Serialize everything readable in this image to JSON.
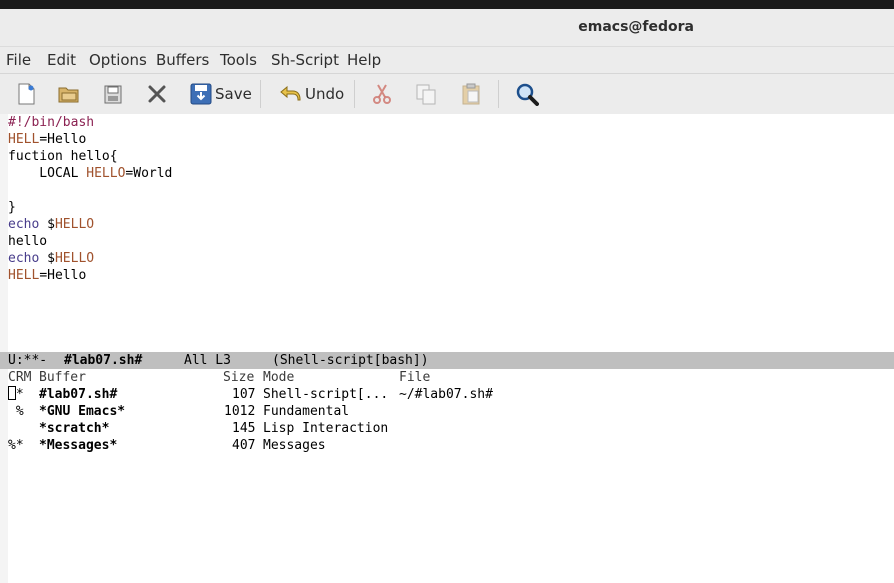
{
  "window": {
    "title": "emacs@fedora"
  },
  "menu": [
    "File",
    "Edit",
    "Options",
    "Buffers",
    "Tools",
    "Sh-Script",
    "Help"
  ],
  "toolbar": {
    "save_label": "Save",
    "undo_label": "Undo",
    "icons": [
      "new-file-icon",
      "open-folder-icon",
      "save-disk-icon",
      "close-icon",
      "save-icon",
      "undo-icon",
      "cut-icon",
      "copy-icon",
      "paste-icon",
      "search-icon"
    ]
  },
  "editor": {
    "lines": [
      {
        "parts": [
          {
            "t": "#!/bin/",
            "c": "pp"
          },
          {
            "t": "bash",
            "c": "pp"
          }
        ]
      },
      {
        "parts": [
          {
            "t": "HELL",
            "c": "var"
          },
          {
            "t": "=Hello",
            "c": ""
          }
        ]
      },
      {
        "parts": [
          {
            "t": "fuction hello{",
            "c": ""
          }
        ]
      },
      {
        "parts": [
          {
            "t": "    LOCAL ",
            "c": ""
          },
          {
            "t": "HELLO",
            "c": "var"
          },
          {
            "t": "=World",
            "c": ""
          }
        ]
      },
      {
        "parts": [
          {
            "t": "",
            "c": ""
          }
        ]
      },
      {
        "parts": [
          {
            "t": "}",
            "c": ""
          }
        ]
      },
      {
        "parts": [
          {
            "t": "echo",
            "c": "bi"
          },
          {
            "t": " $",
            "c": ""
          },
          {
            "t": "HELLO",
            "c": "var"
          }
        ]
      },
      {
        "parts": [
          {
            "t": "hello",
            "c": ""
          }
        ]
      },
      {
        "parts": [
          {
            "t": "echo",
            "c": "bi"
          },
          {
            "t": " $",
            "c": ""
          },
          {
            "t": "HELLO",
            "c": "var"
          }
        ]
      },
      {
        "parts": [
          {
            "t": "HELL",
            "c": "var"
          },
          {
            "t": "=Hello",
            "c": ""
          }
        ]
      }
    ]
  },
  "modeline": {
    "status": "U:**-",
    "buffer": "#lab07.sh#",
    "position": "All L3",
    "mode": "(Shell-script[bash])"
  },
  "buffer_list": {
    "headers": {
      "crm": "CRM",
      "buffer": "Buffer",
      "size": "Size",
      "mode": "Mode",
      "file": "File"
    },
    "rows": [
      {
        "crm": " *",
        "buffer": "#lab07.sh#",
        "size": "107",
        "mode": "Shell-script[...",
        "file": "~/#lab07.sh#",
        "cursor": true
      },
      {
        "crm": " %",
        "buffer": "*GNU Emacs*",
        "size": "1012",
        "mode": "Fundamental",
        "file": ""
      },
      {
        "crm": "",
        "buffer": "*scratch*",
        "size": "145",
        "mode": "Lisp Interaction",
        "file": ""
      },
      {
        "crm": "%*",
        "buffer": "*Messages*",
        "size": "407",
        "mode": "Messages",
        "file": ""
      }
    ]
  }
}
